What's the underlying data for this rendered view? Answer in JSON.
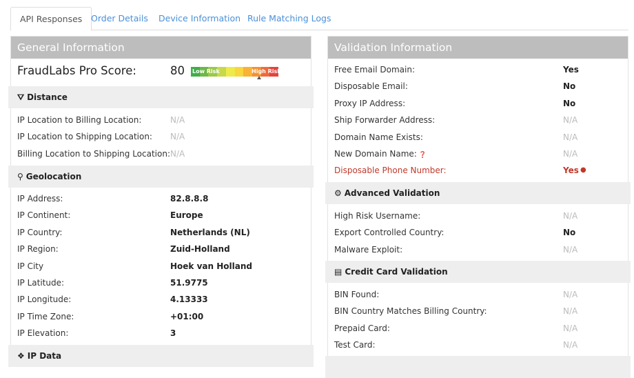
{
  "tabs": [
    "API Responses",
    "Order Details",
    "Device Information",
    "Rule Matching Logs"
  ],
  "general": {
    "title": "General Information",
    "score_label": "FraudLabs Pro Score:",
    "score": "80",
    "gauge_low": "Low Risk",
    "gauge_high": "High Risk",
    "distance": {
      "title": "Distance",
      "rows": [
        [
          "IP Location to Billing Location:",
          "N/A"
        ],
        [
          "IP Location to Shipping Location:",
          "N/A"
        ],
        [
          "Billing Location to Shipping Location:",
          "N/A"
        ]
      ]
    },
    "geo": {
      "title": "Geolocation",
      "rows": [
        [
          "IP Address:",
          "82.8.8.8"
        ],
        [
          "IP Continent:",
          "Europe"
        ],
        [
          "IP Country:",
          "Netherlands (NL)"
        ],
        [
          "IP Region:",
          "Zuid-Holland"
        ],
        [
          "IP City",
          "Hoek van Holland"
        ],
        [
          "IP Latitude:",
          "51.9775"
        ],
        [
          "IP Longitude:",
          "4.13333"
        ],
        [
          "IP Time Zone:",
          "+01:00"
        ],
        [
          "IP Elevation:",
          "3"
        ]
      ]
    },
    "ipdata": {
      "title": "IP Data"
    }
  },
  "validation": {
    "title": "Validation Information",
    "rows": [
      [
        "Free Email Domain:",
        "Yes"
      ],
      [
        "Disposable Email:",
        "No"
      ],
      [
        "Proxy IP Address:",
        "No"
      ],
      [
        "Ship Forwarder Address:",
        "N/A"
      ],
      [
        "Domain Name Exists:",
        "N/A"
      ],
      [
        "New Domain Name:",
        "N/A"
      ],
      [
        "Disposable Phone Number:",
        "Yes"
      ]
    ],
    "advanced": {
      "title": "Advanced Validation",
      "rows": [
        [
          "High Risk Username:",
          "N/A"
        ],
        [
          "Export Controlled Country:",
          "No"
        ],
        [
          "Malware Exploit:",
          "N/A"
        ]
      ]
    },
    "card": {
      "title": "Credit Card Validation",
      "rows": [
        [
          "BIN Found:",
          "N/A"
        ],
        [
          "BIN Country Matches Billing Country:",
          "N/A"
        ],
        [
          "Prepaid Card:",
          "N/A"
        ],
        [
          "Test Card:",
          "N/A"
        ]
      ]
    }
  },
  "colors": {
    "link": "#4a90d9",
    "alert": "#c0392b",
    "gauge": [
      "#3fae49",
      "#6db846",
      "#9bc94a",
      "#c8d84b",
      "#eeea4a",
      "#f8d63e",
      "#f9b233",
      "#f39233",
      "#ee6b3b",
      "#e5433e"
    ]
  }
}
